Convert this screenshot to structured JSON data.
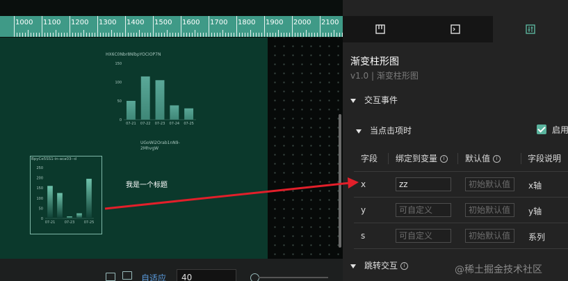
{
  "ruler": {
    "labels": [
      "1000",
      "1100",
      "1200",
      "1300",
      "1400",
      "1500",
      "1600",
      "1700",
      "1800",
      "1900",
      "2000",
      "2100"
    ]
  },
  "canvas": {
    "chart1_title": "HX6C0Nbr8NlbpYOCIOP7N",
    "chart2_title_a": "UGoWi2Orab1nN9-",
    "chart2_title_b": "2MhvgW",
    "chart3_title": "BpyCe5SS1-in-aca03--d",
    "heading_text": "我是一个标题"
  },
  "chart_data": [
    {
      "type": "bar",
      "categories": [
        "07-21",
        "07-22",
        "07-23",
        "07-24",
        "07-25"
      ],
      "values": [
        50,
        115,
        105,
        38,
        30
      ],
      "ylim": [
        0,
        150
      ],
      "ytick_labels": [
        "150",
        "100",
        "50",
        "0"
      ]
    },
    {
      "type": "bar",
      "categories": [
        "07-21",
        "07-22",
        "07-23",
        "07-24",
        "07-25"
      ],
      "values": [
        160,
        125,
        10,
        25,
        195
      ],
      "ylim": [
        0,
        250
      ],
      "ytick_labels": [
        "250",
        "200",
        "150",
        "100",
        "50",
        "0"
      ],
      "xtick_labels": [
        "07-21",
        "07-23",
        "07-25"
      ]
    }
  ],
  "bottom_bar": {
    "adapt_label": "自适应",
    "zoom_value": "40"
  },
  "panel": {
    "tabs": [
      {
        "icon": "layout-icon"
      },
      {
        "icon": "terminal-icon"
      },
      {
        "icon": "settings-sliders-icon"
      }
    ],
    "title": "渐变柱形图",
    "version": "v1.0 | 渐变柱形图",
    "section_interaction": "交互事件",
    "subsection_click": "当点击项时",
    "enable_label": "启用",
    "table": {
      "headers": [
        "字段",
        "绑定到变量",
        "默认值",
        "字段说明"
      ],
      "rows": [
        {
          "field": "x",
          "variable": "zz",
          "variable_placeholder": "可自定义",
          "default_placeholder": "初始默认值",
          "desc": "x轴"
        },
        {
          "field": "y",
          "variable": "",
          "variable_placeholder": "可自定义",
          "default_placeholder": "初始默认值",
          "desc": "y轴"
        },
        {
          "field": "s",
          "variable": "",
          "variable_placeholder": "可自定义",
          "default_placeholder": "初始默认值",
          "desc": "系列"
        }
      ]
    },
    "section_jump": "跳转交互",
    "watermark": "@稀土掘金技术社区"
  },
  "colors": {
    "accent": "#5ab39d",
    "arrow": "#e21f2a",
    "ruler": "#3f9a87",
    "board": "#0b392c"
  }
}
